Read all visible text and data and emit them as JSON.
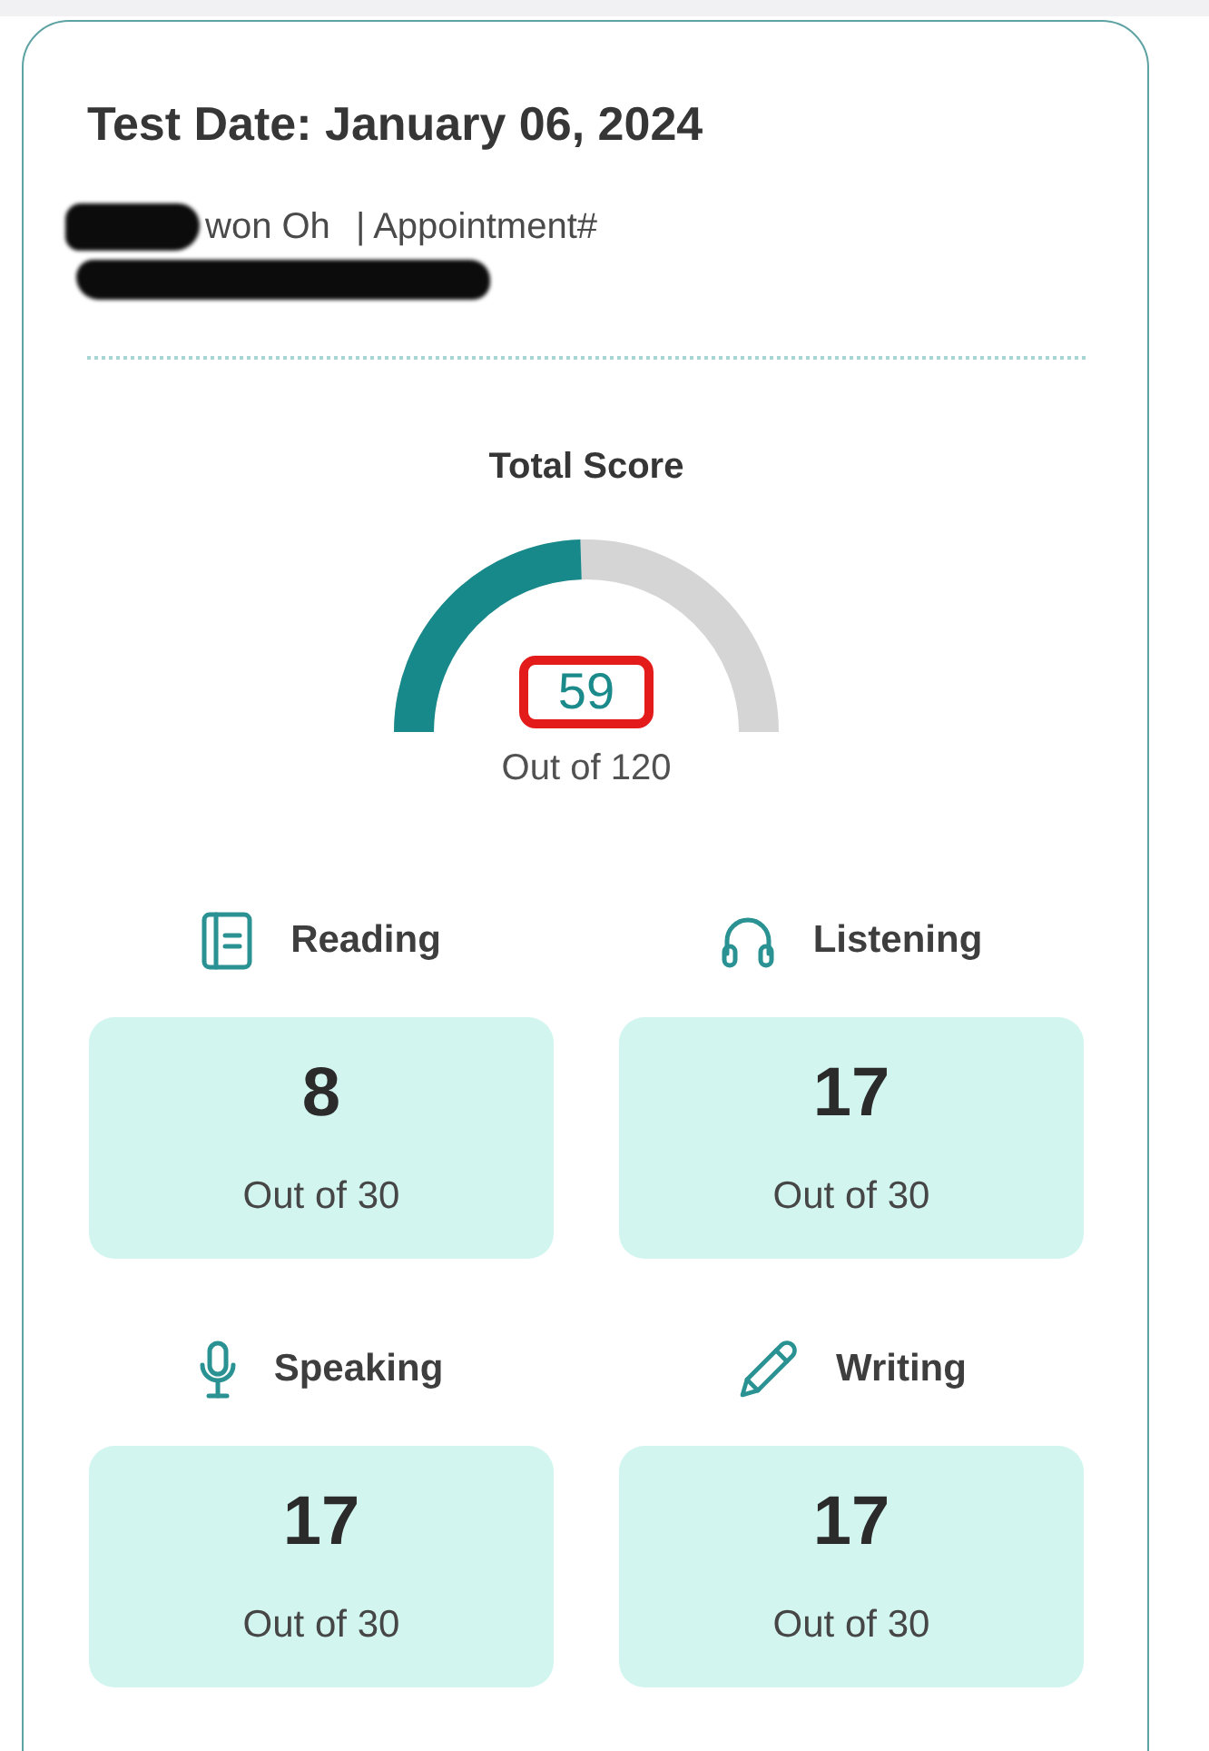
{
  "header": {
    "title": "Test Date: January 06, 2024"
  },
  "candidate": {
    "name": "won Oh",
    "name_redacted": true,
    "appointment_label": "| Appointment#",
    "appointment_redacted": true
  },
  "total_score": {
    "label": "Total Score",
    "value": "59",
    "max_label": "Out of 120",
    "level": 0.49,
    "highlighted": true
  },
  "sections": [
    {
      "kind": "reading",
      "label": "Reading",
      "score": "8",
      "max_label": "Out of 30"
    },
    {
      "kind": "listening",
      "label": "Listening",
      "score": "17",
      "max_label": "Out of 30"
    },
    {
      "kind": "speaking",
      "label": "Speaking",
      "score": "17",
      "max_label": "Out of 30"
    },
    {
      "kind": "writing",
      "label": "Writing",
      "score": "17",
      "max_label": "Out of 30"
    }
  ]
}
